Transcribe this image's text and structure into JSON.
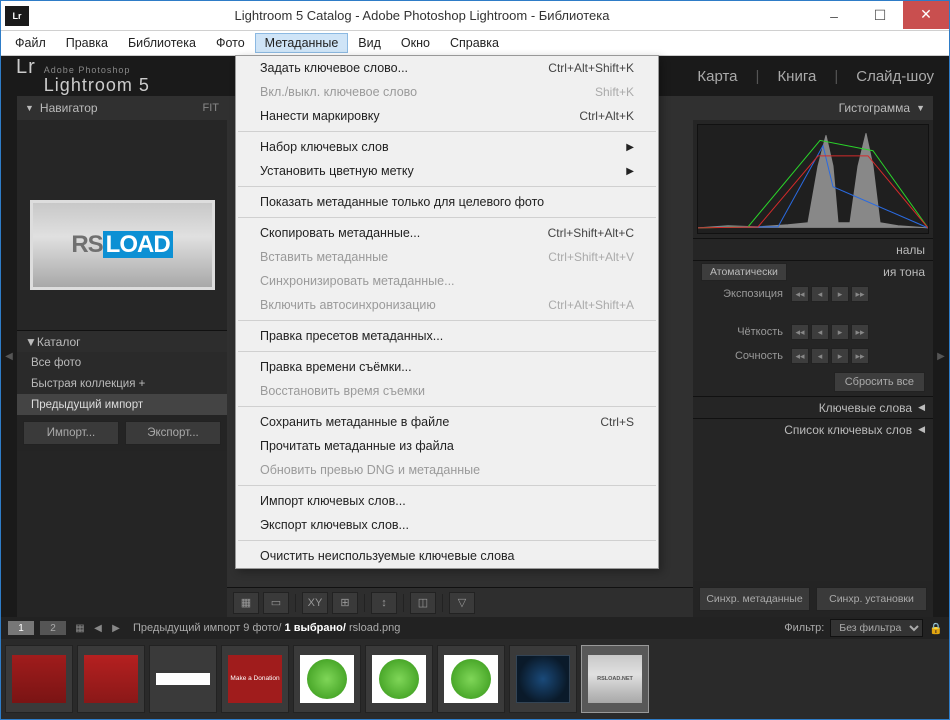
{
  "titlebar": {
    "app_icon": "Lr",
    "title": "Lightroom 5 Catalog - Adobe Photoshop Lightroom - Библиотека"
  },
  "menubar": {
    "items": [
      "Файл",
      "Правка",
      "Библиотека",
      "Фото",
      "Метаданные",
      "Вид",
      "Окно",
      "Справка"
    ],
    "active_index": 4
  },
  "lr_header": {
    "logo_small": "Adobe Photoshop",
    "logo_main": "Lightroom 5",
    "right_items": [
      "Карта",
      "Книга",
      "Слайд-шоу"
    ]
  },
  "left_panel": {
    "navigator": {
      "title": "Навигатор",
      "fit": "FIT"
    },
    "catalog": {
      "title": "Каталог",
      "items": [
        "Все фото",
        "Быстрая коллекция  +",
        "Предыдущий импорт"
      ],
      "selected_index": 2
    },
    "import_btn": "Импорт...",
    "export_btn": "Экспорт..."
  },
  "right_panel": {
    "histogram_title": "Гистограмма",
    "originals": "налы",
    "tone_section": "ия тона",
    "auto_btn": "Атоматически",
    "adjustments": [
      {
        "label": "Экспозиция"
      },
      {
        "label": "Чёткость"
      },
      {
        "label": "Сочность"
      }
    ],
    "reset_btn": "Сбросить все",
    "keywords_title": "Ключевые слова",
    "keyword_list_title": "Список ключевых слов",
    "sync_metadata": "Синхр. метаданные",
    "sync_settings": "Синхр. установки"
  },
  "filmstrip": {
    "pages": [
      "1",
      "2"
    ],
    "path_text": "Предыдущий импорт  9 фото/",
    "selected_text": "1 выбрано/",
    "filename": "rsload.png",
    "filter_label": "Фильтр:",
    "filter_value": "Без фильтра"
  },
  "dropdown": {
    "items": [
      {
        "label": "Задать ключевое слово...",
        "shortcut": "Ctrl+Alt+Shift+K",
        "type": "item"
      },
      {
        "label": "Вкл./выкл. ключевое слово",
        "shortcut": "Shift+K",
        "type": "item",
        "disabled": true
      },
      {
        "label": "Нанести маркировку",
        "shortcut": "Ctrl+Alt+K",
        "type": "item"
      },
      {
        "type": "sep"
      },
      {
        "label": "Набор ключевых слов",
        "type": "submenu"
      },
      {
        "label": "Установить цветную метку",
        "type": "submenu"
      },
      {
        "type": "sep"
      },
      {
        "label": "Показать метаданные только для целевого фото",
        "type": "item"
      },
      {
        "type": "sep"
      },
      {
        "label": "Скопировать метаданные...",
        "shortcut": "Ctrl+Shift+Alt+C",
        "type": "item"
      },
      {
        "label": "Вставить метаданные",
        "shortcut": "Ctrl+Shift+Alt+V",
        "type": "item",
        "disabled": true
      },
      {
        "label": "Синхронизировать метаданные...",
        "type": "item",
        "disabled": true
      },
      {
        "label": "Включить автосинхронизацию",
        "shortcut": "Ctrl+Alt+Shift+A",
        "type": "item",
        "disabled": true
      },
      {
        "type": "sep"
      },
      {
        "label": "Правка пресетов метаданных...",
        "type": "item"
      },
      {
        "type": "sep"
      },
      {
        "label": "Правка времени съёмки...",
        "type": "item"
      },
      {
        "label": "Восстановить время съемки",
        "type": "item",
        "disabled": true
      },
      {
        "type": "sep"
      },
      {
        "label": "Сохранить метаданные в файле",
        "shortcut": "Ctrl+S",
        "type": "item"
      },
      {
        "label": "Прочитать метаданные из файла",
        "type": "item"
      },
      {
        "label": "Обновить превью DNG и метаданные",
        "type": "item",
        "disabled": true
      },
      {
        "type": "sep"
      },
      {
        "label": "Импорт ключевых слов...",
        "type": "item"
      },
      {
        "label": "Экспорт ключевых слов...",
        "type": "item"
      },
      {
        "type": "sep"
      },
      {
        "label": "Очистить неиспользуемые ключевые слова",
        "type": "item"
      }
    ]
  },
  "thumbs": [
    {
      "bg": "#2a2a2a",
      "inner_bg": "linear-gradient(#a01c1c,#7a1414)",
      "inner_border": ""
    },
    {
      "bg": "#2a2a2a",
      "inner_bg": "linear-gradient(#b52020,#8a1818)",
      "inner_border": ""
    },
    {
      "bg": "#2a2a2a",
      "inner_bg": "#fff",
      "inner_style": "height:12px"
    },
    {
      "bg": "#2a2a2a",
      "inner_bg": "#a01c1c",
      "text": "Make a Donation",
      "text_style": "font-size:6.5px;color:#fff;text-align:center;line-height:48px"
    },
    {
      "bg": "#2a2a2a",
      "inner_bg": "#fff",
      "circle": "#4aa82a"
    },
    {
      "bg": "#2a2a2a",
      "inner_bg": "#fff",
      "circle": "#4aa82a"
    },
    {
      "bg": "#2a2a2a",
      "inner_bg": "#fff",
      "circle": "#4aa82a"
    },
    {
      "bg": "#2a2a2a",
      "inner_bg": "radial-gradient(circle,#1a4a7a 0%,#0a1a2a 70%)",
      "inner_border": "1px solid #345"
    },
    {
      "bg": "#585858",
      "inner_bg": "linear-gradient(180deg,#c8c8c8 0%,#e0e0e0 40%,#a8a8a8 100%)",
      "text": "RSLOAD.NET",
      "text_style": "font-size:5.5px;font-weight:bold;color:#555;text-align:center;line-height:48px",
      "selected": true
    }
  ]
}
